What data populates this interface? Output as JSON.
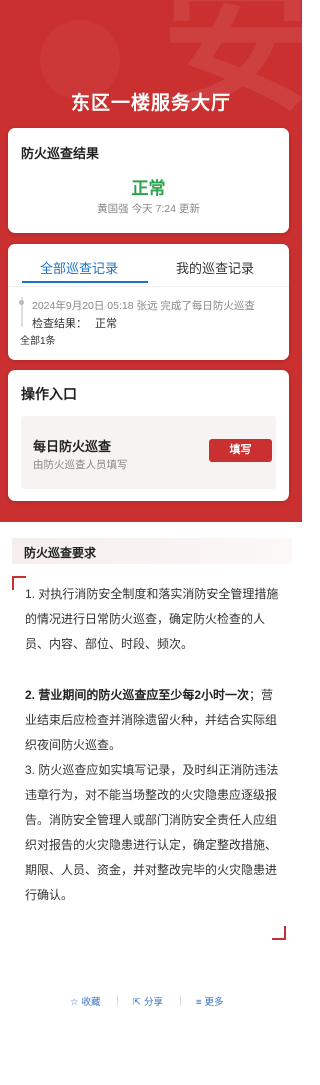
{
  "page": {
    "title": "东区一楼服务大厅",
    "accent": "#c9302f"
  },
  "result_card": {
    "title": "防火巡查结果",
    "status": "正常",
    "status_color": "#2ba24c",
    "updated": "黄国强 今天 7:24 更新"
  },
  "records": {
    "tabs": [
      {
        "label": "全部巡查记录",
        "active": true
      },
      {
        "label": "我的巡查记录",
        "active": false
      }
    ],
    "items": [
      {
        "text": "2024年9月20日 05:18 张远 完成了每日防火巡查",
        "result_label": "检查结果：",
        "result_value": "正常"
      }
    ],
    "total": "全部1条"
  },
  "operations": {
    "title": "操作入口",
    "items": [
      {
        "name": "每日防火巡查",
        "desc": "由防火巡查人员填写",
        "button": "填写"
      }
    ]
  },
  "requirements": {
    "title": "防火巡查要求",
    "p1": "1. 对执行消防安全制度和落实消防安全管理措施的情况进行日常防火巡查，确定防火检查的人员、内容、部位、时段、频次。",
    "p2_bold": "2. 营业期间的防火巡查应至少每2小时一次",
    "p2_rest": "；营业结束后应检查并消除遗留火种，并结合实际组织夜间防火巡查。",
    "p3": "3. 防火巡查应如实填写记录，及时纠正消防违法违章行为，对不能当场整改的火灾隐患应逐级报告。消防安全管理人或部门消防安全责任人应组织对报告的火灾隐患进行认定，确定整改措施、期限、人员、资金，并对整改完毕的火灾隐患进行确认。"
  },
  "footer": {
    "favorite": "收藏",
    "favorite_icon": "star-icon",
    "share": "分享",
    "share_icon": "share-icon",
    "more": "更多",
    "more_icon": "menu-icon"
  }
}
